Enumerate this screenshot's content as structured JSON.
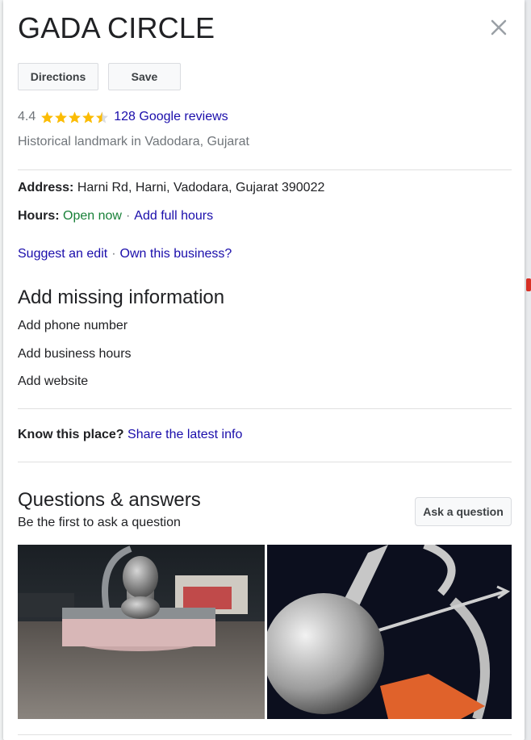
{
  "place": {
    "title": "GADA CIRCLE",
    "rating": "4.4",
    "reviews_link": "128 Google reviews",
    "category": "Historical landmark in Vadodara, Gujarat"
  },
  "actions": {
    "directions_label": "Directions",
    "save_label": "Save"
  },
  "details": {
    "address_label": "Address:",
    "address_value": "Harni Rd, Harni, Vadodara, Gujarat 390022",
    "hours_label": "Hours:",
    "hours_status": "Open now",
    "separator": "·",
    "add_hours_link": "Add full hours"
  },
  "edits": {
    "suggest_edit": "Suggest an edit",
    "separator": "·",
    "own_business": "Own this business?"
  },
  "missing_info": {
    "heading": "Add missing information",
    "items": [
      "Add phone number",
      "Add business hours",
      "Add website"
    ]
  },
  "know_place": {
    "label": "Know this place?",
    "link": "Share the latest info"
  },
  "qa": {
    "heading": "Questions & answers",
    "first_link": "Be the first to ask a question",
    "ask_button": "Ask a question"
  },
  "colors": {
    "link": "#1a0dab",
    "open_green": "#188038",
    "star": "#fbbc04",
    "muted": "#70757a"
  },
  "icons": {
    "close": "close-icon",
    "star": "star-icon"
  }
}
